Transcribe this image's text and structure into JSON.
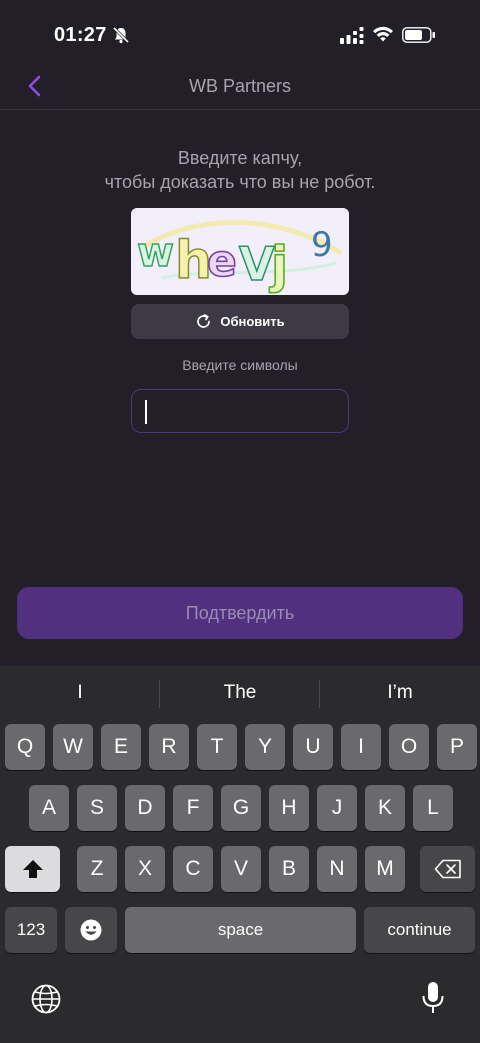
{
  "status_bar": {
    "time": "01:27"
  },
  "nav": {
    "title": "WB Partners"
  },
  "captcha": {
    "prompt_line1": "Введите капчу,",
    "prompt_line2": "чтобы доказать что вы не робот.",
    "image_text": "whe vj 9",
    "refresh_label": "Обновить",
    "input_label": "Введите символы",
    "input_value": ""
  },
  "confirm": {
    "label": "Подтвердить"
  },
  "keyboard": {
    "suggestions": [
      "I",
      "The",
      "I’m"
    ],
    "row1": [
      "Q",
      "W",
      "E",
      "R",
      "T",
      "Y",
      "U",
      "I",
      "O",
      "P"
    ],
    "row2": [
      "A",
      "S",
      "D",
      "F",
      "G",
      "H",
      "J",
      "K",
      "L"
    ],
    "row3": [
      "Z",
      "X",
      "C",
      "V",
      "B",
      "N",
      "M"
    ],
    "numbers_label": "123",
    "space_label": "space",
    "continue_label": "continue"
  }
}
